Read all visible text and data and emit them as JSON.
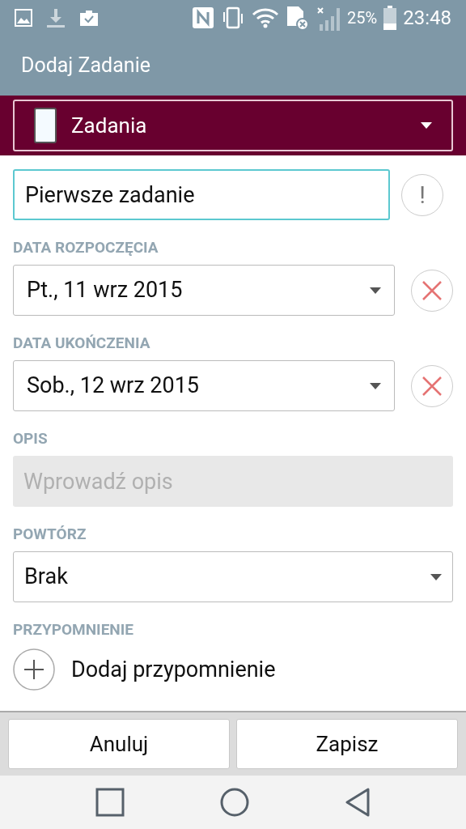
{
  "status_bar": {
    "battery": "25%",
    "time": "23:48"
  },
  "app_bar": {
    "title": "Dodaj Zadanie"
  },
  "list_selector": {
    "value": "Zadania"
  },
  "title_field": {
    "value": "Pierwsze zadanie",
    "focused": true,
    "priority_symbol": "!"
  },
  "start_date": {
    "label": "DATA ROZPOCZĘCIA",
    "value": "Pt., 11 wrz 2015"
  },
  "end_date": {
    "label": "DATA UKOŃCZENIA",
    "value": "Sob., 12 wrz 2015"
  },
  "description": {
    "label": "OPIS",
    "placeholder": "Wprowadź opis"
  },
  "repeat": {
    "label": "POWTÓRZ",
    "value": "Brak"
  },
  "reminder": {
    "label": "PRZYPOMNIENIE",
    "action": "Dodaj przypomnienie"
  },
  "buttons": [
    "Anuluj",
    "Zapisz"
  ]
}
